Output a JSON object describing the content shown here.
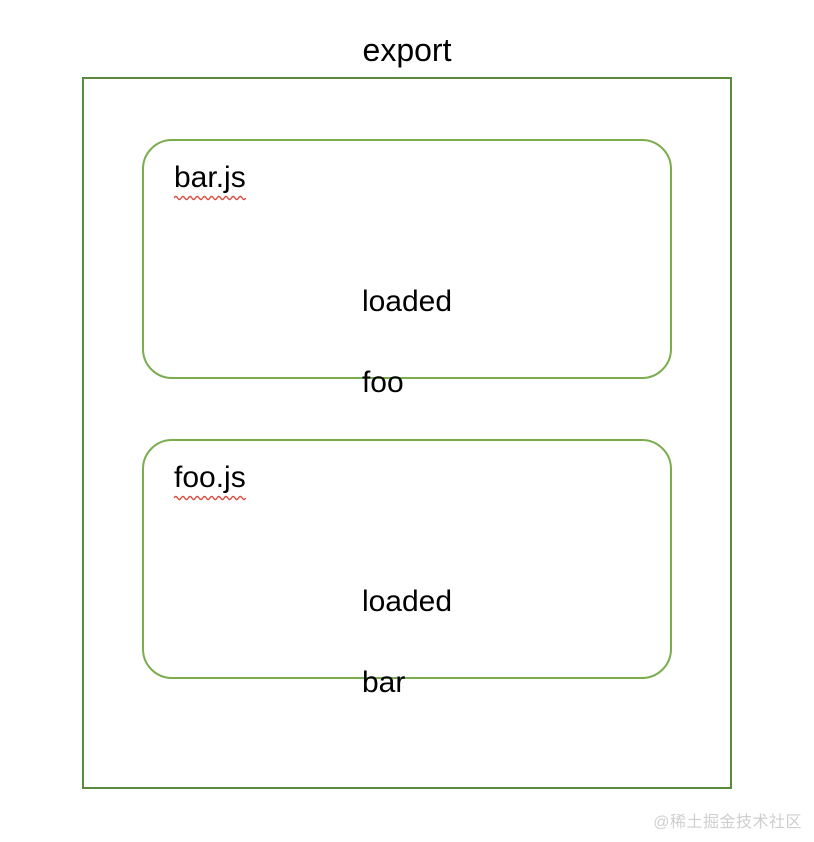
{
  "title": "export",
  "modules": [
    {
      "name": "bar.js",
      "content_line1": "loaded",
      "content_line2": "foo"
    },
    {
      "name": "foo.js",
      "content_line1": "loaded",
      "content_line2": "bar"
    }
  ],
  "watermark": "@稀土掘金技术社区",
  "colors": {
    "border_outer": "#5b8c3e",
    "border_inner": "#7aad4e",
    "squiggle": "#d94a3a"
  }
}
